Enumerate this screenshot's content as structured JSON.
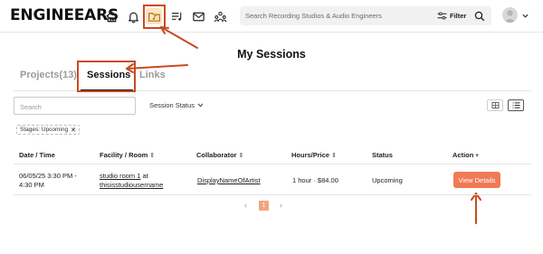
{
  "header": {
    "logo": "ENGINEEARS",
    "search": {
      "placeholder": "Search Recording Studios & Audio Engineers"
    },
    "filter_label": "Filter",
    "icons": [
      "home-icon",
      "bell-icon",
      "folder-music-icon",
      "playlist-icon",
      "mail-icon",
      "community-icon",
      "filter-icon",
      "search-icon",
      "user-avatar-icon",
      "chevron-down-icon"
    ]
  },
  "page": {
    "title": "My Sessions"
  },
  "tabs": [
    {
      "label": "Projects(13)",
      "active": false
    },
    {
      "label": "Sessions",
      "active": true
    },
    {
      "label": "Links",
      "active": false
    }
  ],
  "filters": {
    "search_placeholder": "Search",
    "status_label": "Session Status",
    "chip_label": "Stages: Upcoming",
    "chip_close": "✕"
  },
  "table": {
    "headers": [
      "Date / Time",
      "Facility / Room",
      "Collaborator",
      "Hours/Price",
      "Status",
      "Action"
    ],
    "rows": [
      {
        "date_line1": "06/05/25 3:30 PM -",
        "date_line2": "4:30 PM",
        "room_line1": "studio room 1",
        "room_at": " at",
        "room_line2": "thisisstudiousername",
        "collaborator": "DisplayNameOfArtist",
        "hours_price": "1 hour · $84.00",
        "status": "Upcoming",
        "action": "View Details"
      }
    ]
  },
  "pagination": {
    "current": "1",
    "prev": "‹",
    "next": "›"
  },
  "colors": {
    "accent": "#f07a55",
    "annotation": "#c84b22",
    "active_nav_bg": "#fbe6bf",
    "page_active": "#f4a37e"
  }
}
